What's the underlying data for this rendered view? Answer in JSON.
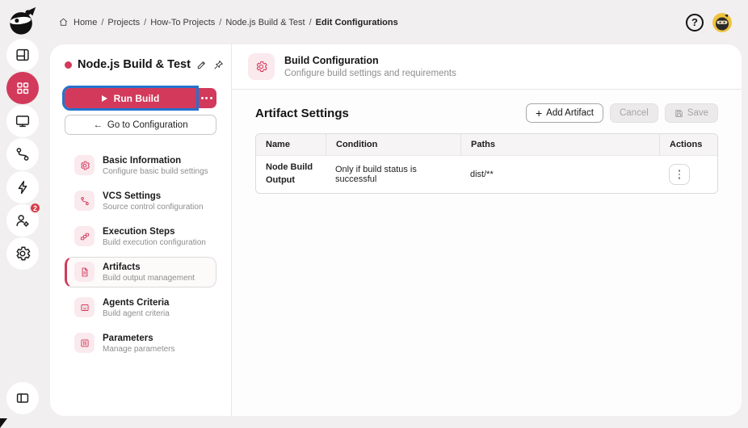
{
  "colors": {
    "accent_crimson": "#d2395a",
    "accent_light_pink": "#fae9ed",
    "focus_blue": "#2472cc",
    "avatar_gold": "#eec23c",
    "badge_red": "#d63c47",
    "page_background": "#f1efef"
  },
  "topbar": {
    "breadcrumbs": [
      "Home",
      "Projects",
      "How-To Projects",
      "Node.js Build & Test",
      "Edit Configurations"
    ],
    "separator": "/",
    "help_glyph": "?"
  },
  "sidebar": {
    "icons": [
      "ninja-logo",
      "layout-icon",
      "grid-icon (active)",
      "monitor-icon",
      "branch-icon",
      "lightning-icon",
      "user-gear-icon",
      "gear-icon",
      "collapse-panel-icon"
    ],
    "user_badge": "2"
  },
  "project_panel": {
    "title": "Node.js Build & Test",
    "run_button": {
      "label": "Run Build"
    },
    "goto_button": {
      "icon": "←",
      "label": "Go to Configuration"
    },
    "nav": [
      {
        "title": "Basic Information",
        "subtitle": "Configure basic build settings"
      },
      {
        "title": "VCS Settings",
        "subtitle": "Source control configuration"
      },
      {
        "title": "Execution Steps",
        "subtitle": "Build execution configuration"
      },
      {
        "title": "Artifacts",
        "subtitle": "Build output management"
      },
      {
        "title": "Agents Criteria",
        "subtitle": "Build agent criteria"
      },
      {
        "title": "Parameters",
        "subtitle": "Manage parameters"
      }
    ],
    "selected_nav": "Artifacts"
  },
  "main": {
    "header": {
      "title": "Build Configuration",
      "subtitle": "Configure build settings and requirements"
    },
    "section": {
      "title": "Artifact Settings",
      "add_button": {
        "icon": "+",
        "label": "Add Artifact"
      },
      "cancel_button": "Cancel",
      "save_button": "Save"
    },
    "table": {
      "columns": [
        "Name",
        "Condition",
        "Paths",
        "Actions"
      ],
      "rows": [
        {
          "name": "Node Build Output",
          "condition": "Only if build status is successful",
          "paths": "dist/**"
        }
      ]
    }
  }
}
